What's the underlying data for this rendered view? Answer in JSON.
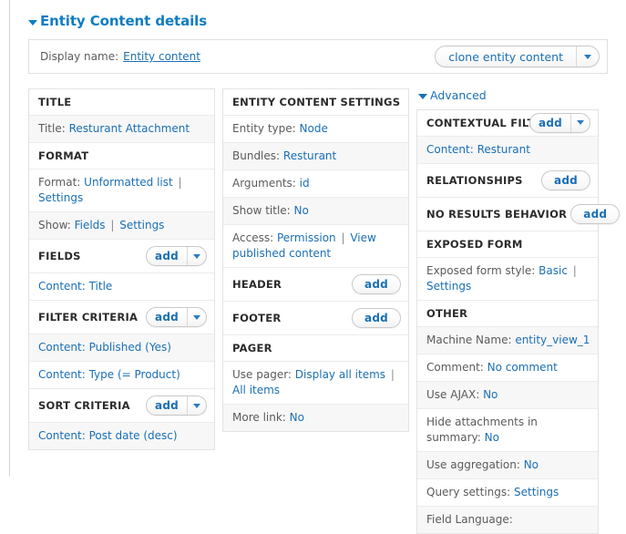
{
  "header": {
    "title": "Entity Content details",
    "toggle_icon": "triangle-down-icon"
  },
  "display_bar": {
    "label": "Display name:",
    "value": "Entity content",
    "clone_button": "clone entity content",
    "clone_caret_icon": "chevron-down-icon"
  },
  "add_label": "add",
  "columns": {
    "left": [
      {
        "heading": "TITLE",
        "button": null,
        "rows": [
          {
            "label": "Title:",
            "links": [
              "Resturant Attachment"
            ],
            "alt": true
          }
        ]
      },
      {
        "heading": "FORMAT",
        "button": null,
        "rows": [
          {
            "label": "Format:",
            "links": [
              "Unformatted list",
              "Settings"
            ],
            "alt": false
          },
          {
            "label": "Show:",
            "links": [
              "Fields",
              "Settings"
            ],
            "alt": true
          }
        ]
      },
      {
        "heading": "FIELDS",
        "button": "add",
        "button_caret": true,
        "rows": [
          {
            "label": "",
            "links": [
              "Content: Title"
            ],
            "alt": false
          }
        ]
      },
      {
        "heading": "FILTER CRITERIA",
        "button": "add",
        "button_caret": true,
        "rows": [
          {
            "label": "",
            "links": [
              "Content: Published (Yes)"
            ],
            "alt": true
          },
          {
            "label": "",
            "links": [
              "Content: Type (= Product)"
            ],
            "alt": false
          }
        ]
      },
      {
        "heading": "SORT CRITERIA",
        "button": "add",
        "button_caret": true,
        "rows": [
          {
            "label": "",
            "links": [
              "Content: Post date (desc)"
            ],
            "alt": true
          }
        ]
      }
    ],
    "middle": [
      {
        "heading": "ENTITY CONTENT SETTINGS",
        "button": null,
        "rows": [
          {
            "label": "Entity type:",
            "links": [
              "Node"
            ],
            "alt": false
          },
          {
            "label": "Bundles:",
            "links": [
              "Resturant"
            ],
            "alt": true
          },
          {
            "label": "Arguments:",
            "links": [
              "id"
            ],
            "alt": false
          },
          {
            "label": "Show title:",
            "links": [
              "No"
            ],
            "alt": true
          },
          {
            "label": "Access:",
            "links": [
              "Permission",
              "View published content"
            ],
            "alt": false
          }
        ]
      },
      {
        "heading": "HEADER",
        "button": "add",
        "button_caret": false,
        "rows": []
      },
      {
        "heading": "FOOTER",
        "button": "add",
        "button_caret": false,
        "rows": []
      },
      {
        "heading": "PAGER",
        "button": null,
        "rows": [
          {
            "label": "Use pager:",
            "links": [
              "Display all items",
              "All items"
            ],
            "alt": false
          },
          {
            "label": "More link:",
            "links": [
              "No"
            ],
            "alt": true
          }
        ]
      }
    ],
    "right_top_label": "Advanced",
    "right": [
      {
        "heading": "CONTEXTUAL FILTERS",
        "button": "add",
        "button_caret": true,
        "overlap": true,
        "rows": [
          {
            "label": "",
            "links": [
              "Content: Resturant"
            ],
            "alt": true
          }
        ]
      },
      {
        "heading": "RELATIONSHIPS",
        "button": "add",
        "button_caret": false,
        "rows": []
      },
      {
        "heading": "NO RESULTS BEHAVIOR",
        "button": "add",
        "button_caret": false,
        "rows": []
      },
      {
        "heading": "EXPOSED FORM",
        "button": null,
        "rows": [
          {
            "label": "Exposed form style:",
            "links": [
              "Basic",
              "Settings"
            ],
            "alt": false
          }
        ]
      },
      {
        "heading": "OTHER",
        "button": null,
        "rows": [
          {
            "label": "Machine Name:",
            "links": [
              "entity_view_1"
            ],
            "alt": true
          },
          {
            "label": "Comment:",
            "links": [
              "No comment"
            ],
            "alt": false
          },
          {
            "label": "Use AJAX:",
            "links": [
              "No"
            ],
            "alt": true
          },
          {
            "label": "Hide attachments in summary:",
            "links": [
              "No"
            ],
            "alt": false
          },
          {
            "label": "Use aggregation:",
            "links": [
              "No"
            ],
            "alt": true
          },
          {
            "label": "Query settings:",
            "links": [
              "Settings"
            ],
            "alt": false
          },
          {
            "label": "Field Language:",
            "links": [],
            "alt": true
          }
        ]
      }
    ]
  },
  "colors": {
    "link": "#1a6fb5",
    "title": "#0f7dc2",
    "label": "#5b5b5b",
    "row_alt": "#f7f7f7",
    "border": "#e3e3e3"
  }
}
